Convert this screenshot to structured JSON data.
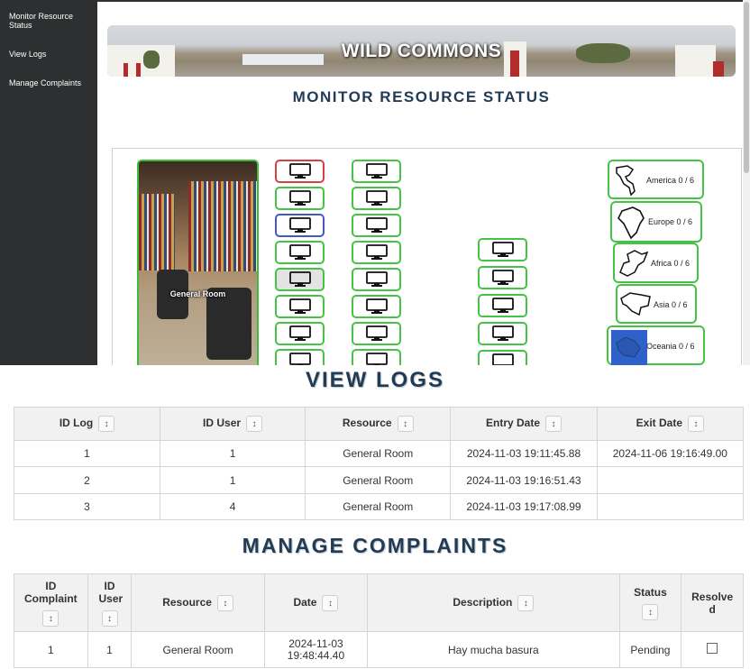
{
  "sidebar": {
    "items": [
      {
        "label": "Monitor Resource Status"
      },
      {
        "label": "View Logs"
      },
      {
        "label": "Manage Complaints"
      }
    ]
  },
  "banner": {
    "title": "WILD COMMONS"
  },
  "monitor": {
    "title": "MONITOR RESOURCE STATUS",
    "room_label": "General Room",
    "regions": [
      {
        "name": "America",
        "label": "America 0 / 6"
      },
      {
        "name": "Europe",
        "label": "Europe 0 / 6"
      },
      {
        "name": "Africa",
        "label": "Africa 0 / 6"
      },
      {
        "name": "Asia",
        "label": "Asia 0 / 6"
      },
      {
        "name": "Oceania",
        "label": "Oceania 0 / 6"
      }
    ]
  },
  "logs": {
    "title": "VIEW LOGS",
    "headers": [
      "ID Log",
      "ID User",
      "Resource",
      "Entry Date",
      "Exit Date"
    ],
    "rows": [
      [
        "1",
        "1",
        "General Room",
        "2024-11-03 19:11:45.88",
        "2024-11-06 19:16:49.00"
      ],
      [
        "2",
        "1",
        "General Room",
        "2024-11-03 19:16:51.43",
        ""
      ],
      [
        "3",
        "4",
        "General Room",
        "2024-11-03 19:17:08.99",
        ""
      ]
    ]
  },
  "complaints": {
    "title": "MANAGE COMPLAINTS",
    "headers": {
      "id_complaint": "ID Complaint",
      "id_user": "ID User",
      "resource": "Resource",
      "date": "Date",
      "description": "Description",
      "status": "Status",
      "resolved": "Resolved"
    },
    "rows": [
      {
        "id": "1",
        "user": "1",
        "resource": "General Room",
        "date": "2024-11-03 19:48:44.40",
        "description": "Hay mucha basura",
        "status": "Pending"
      }
    ]
  },
  "icons": {
    "sort": "sort-arrows-icon",
    "computer": "monitor-icon"
  },
  "colors": {
    "available": "#45c345",
    "occupied": "#d64040",
    "selected": "#4457c9",
    "title": "#223c55",
    "sidebar": "#2e2f30"
  }
}
